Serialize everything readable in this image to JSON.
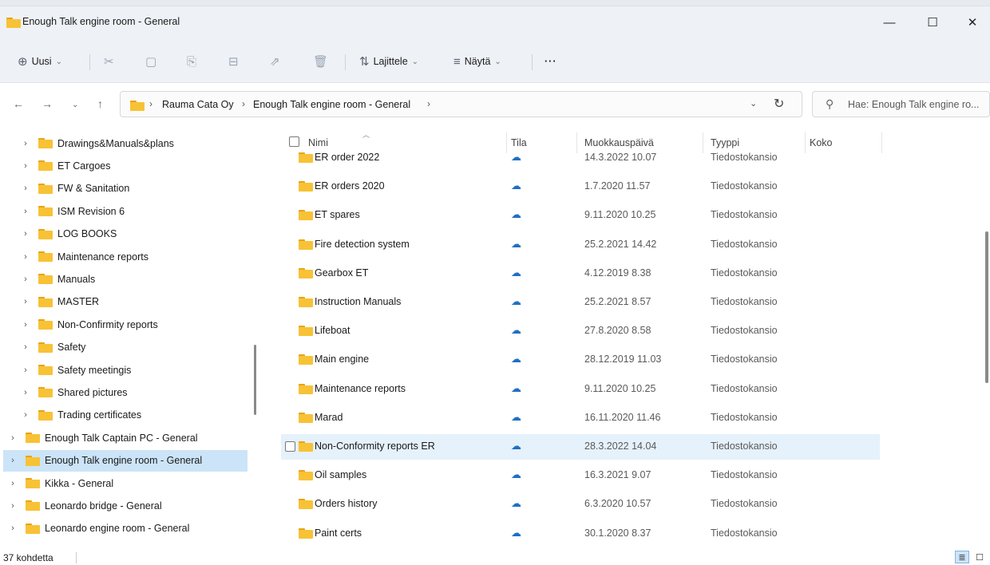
{
  "window": {
    "title": "Enough Talk engine room - General",
    "min_glyph": "—",
    "max_glyph": "☐",
    "close_glyph": "✕"
  },
  "commands": {
    "new_label": "Uusi",
    "sort_label": "Lajittele",
    "view_label": "Näytä",
    "more_glyph": "···"
  },
  "address": {
    "crumbs": [
      "Rauma Cata Oy",
      "Enough Talk engine room - General"
    ],
    "search_placeholder": "Hae: Enough Talk engine ro..."
  },
  "sidebar": {
    "items": [
      {
        "label": "Drawings&Manuals&plans",
        "level": 2
      },
      {
        "label": "ET Cargoes",
        "level": 2
      },
      {
        "label": "FW & Sanitation",
        "level": 2
      },
      {
        "label": "ISM Revision 6",
        "level": 2
      },
      {
        "label": "LOG BOOKS",
        "level": 2
      },
      {
        "label": "Maintenance reports",
        "level": 2
      },
      {
        "label": "Manuals",
        "level": 2
      },
      {
        "label": "MASTER",
        "level": 2
      },
      {
        "label": "Non-Confirmity reports",
        "level": 2
      },
      {
        "label": "Safety",
        "level": 2
      },
      {
        "label": "Safety meetingis",
        "level": 2
      },
      {
        "label": "Shared pictures",
        "level": 2
      },
      {
        "label": "Trading certificates",
        "level": 2
      },
      {
        "label": "Enough Talk Captain PC - General",
        "level": 1
      },
      {
        "label": "Enough Talk engine room - General",
        "level": 1,
        "selected": true
      },
      {
        "label": "Kikka - General",
        "level": 1
      },
      {
        "label": "Leonardo bridge - General",
        "level": 1
      },
      {
        "label": "Leonardo engine room - General",
        "level": 1
      }
    ]
  },
  "columns": {
    "name": "Nimi",
    "status": "Tila",
    "modified": "Muokkauspäivä",
    "type": "Tyyppi",
    "size": "Koko"
  },
  "files": [
    {
      "name": "ER order 2022",
      "date": "14.3.2022 10.07",
      "type": "Tiedostokansio"
    },
    {
      "name": "ER orders 2020",
      "date": "1.7.2020 11.57",
      "type": "Tiedostokansio"
    },
    {
      "name": "ET spares",
      "date": "9.11.2020 10.25",
      "type": "Tiedostokansio"
    },
    {
      "name": "Fire detection system",
      "date": "25.2.2021 14.42",
      "type": "Tiedostokansio"
    },
    {
      "name": "Gearbox ET",
      "date": "4.12.2019 8.38",
      "type": "Tiedostokansio"
    },
    {
      "name": "Instruction Manuals",
      "date": "25.2.2021 8.57",
      "type": "Tiedostokansio"
    },
    {
      "name": "Lifeboat",
      "date": "27.8.2020 8.58",
      "type": "Tiedostokansio"
    },
    {
      "name": "Main engine",
      "date": "28.12.2019 11.03",
      "type": "Tiedostokansio"
    },
    {
      "name": "Maintenance reports",
      "date": "9.11.2020 10.25",
      "type": "Tiedostokansio"
    },
    {
      "name": "Marad",
      "date": "16.11.2020 11.46",
      "type": "Tiedostokansio"
    },
    {
      "name": "Non-Conformity reports ER",
      "date": "28.3.2022 14.04",
      "type": "Tiedostokansio",
      "selected": true
    },
    {
      "name": "Oil samples",
      "date": "16.3.2021 9.07",
      "type": "Tiedostokansio"
    },
    {
      "name": "Orders history",
      "date": "6.3.2020 10.57",
      "type": "Tiedostokansio"
    },
    {
      "name": "Paint certs",
      "date": "30.1.2020 8.37",
      "type": "Tiedostokansio"
    }
  ],
  "status": {
    "count": "37 kohdetta"
  },
  "colors": {
    "accent": "#1f6fc4",
    "selection": "#cce4f7",
    "folder": "#f8c236"
  }
}
